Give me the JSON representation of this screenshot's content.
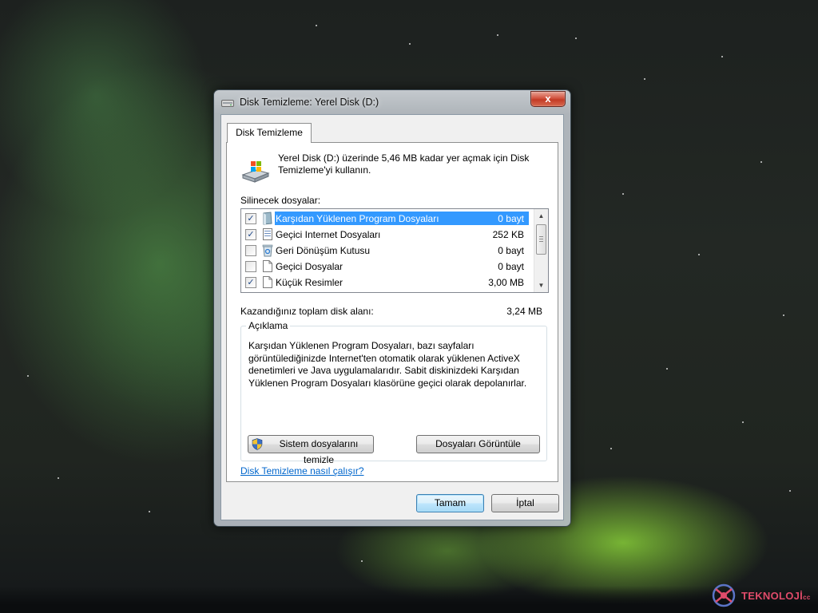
{
  "window": {
    "title": "Disk Temizleme:  Yerel Disk (D:)",
    "close_symbol": "x"
  },
  "tab": {
    "label": "Disk Temizleme"
  },
  "intro": {
    "text": "Yerel Disk (D:) üzerinde 5,46 MB kadar yer açmak için Disk Temizleme'yi kullanın.",
    "icon": "disk-cleanup-icon"
  },
  "files": {
    "label": "Silinecek dosyalar:",
    "items": [
      {
        "name": "Karşıdan Yüklenen Program Dosyaları",
        "size": "0 bayt",
        "checked": true,
        "selected": true,
        "icon": "folder-icon"
      },
      {
        "name": "Geçici Internet Dosyaları",
        "size": "252 KB",
        "checked": true,
        "selected": false,
        "icon": "document-icon"
      },
      {
        "name": "Geri Dönüşüm Kutusu",
        "size": "0 bayt",
        "checked": false,
        "selected": false,
        "icon": "recycle-bin-icon"
      },
      {
        "name": "Geçici Dosyalar",
        "size": "0 bayt",
        "checked": false,
        "selected": false,
        "icon": "blank-file-icon"
      },
      {
        "name": "Küçük Resimler",
        "size": "3,00 MB",
        "checked": true,
        "selected": false,
        "icon": "blank-file-icon"
      }
    ]
  },
  "gain": {
    "label": "Kazandığınız toplam disk alanı:",
    "value": "3,24 MB"
  },
  "description": {
    "title": "Açıklama",
    "text": "Karşıdan Yüklenen Program Dosyaları, bazı sayfaları görüntülediğinizde Internet'ten otomatik olarak yüklenen ActiveX denetimleri ve Java uygulamalarıdır. Sabit diskinizdeki Karşıdan Yüklenen Program Dosyaları klasörüne geçici olarak depolanırlar."
  },
  "buttons": {
    "system_clean": "Sistem dosyalarını temizle",
    "view_files": "Dosyaları Görüntüle",
    "ok": "Tamam",
    "cancel": "İptal"
  },
  "help_link": "Disk Temizleme nasıl çalışır?",
  "watermark": {
    "text": "TEKNOLOJİ",
    "suffix": "cc"
  },
  "colors": {
    "selection": "#3399ff",
    "link": "#0066cc",
    "close": "#c23a25"
  }
}
